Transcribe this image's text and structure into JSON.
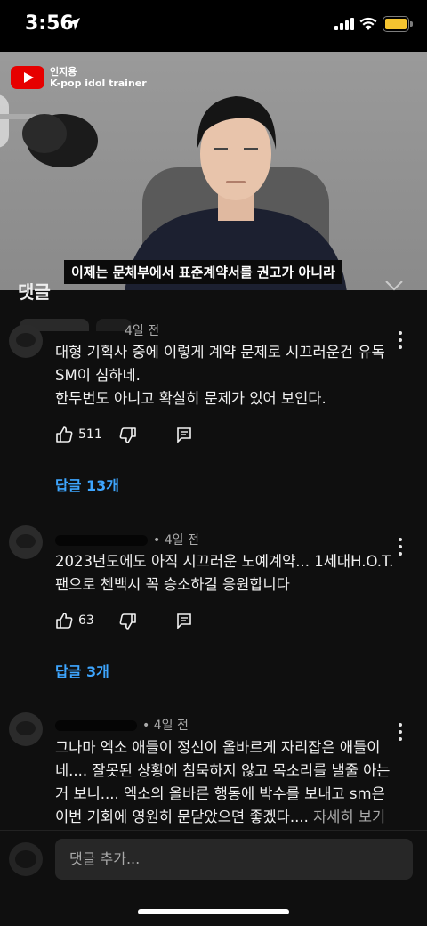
{
  "status": {
    "time": "3:56"
  },
  "video": {
    "channel": "인지용",
    "subtitle_line": "K-pop idol trainer",
    "caption": "이제는 문체부에서 표준계약서를 권고가 아니라"
  },
  "panel": {
    "title_fragment": "댓글"
  },
  "comments": [
    {
      "age": "4일 전",
      "lines": [
        "대형 기획사 중에 이렇게 계약 문제로 시끄러운건 유독",
        "SM이 심하네.",
        "한두번도 아니고 확실히 문제가 있어 보인다."
      ],
      "likes": "511",
      "reply_label": "답글 13개"
    },
    {
      "age": "4일 전",
      "lines": [
        "2023년도에도 아직 시끄러운 노예계약... 1세대H.O.T.",
        "팬으로 첸백시 꼭 승소하길 응원합니다"
      ],
      "likes": "63",
      "reply_label": "답글 3개"
    },
    {
      "age": "4일 전",
      "lines": [
        "그나마 엑소 애들이 정신이 올바르게 자리잡은 애들이",
        "네.... 잘못된 상황에 침묵하지 않고 목소리를 낼줄 아는",
        "거 보니....  엑소의 올바른 행동에 박수를 보내고 sm은",
        "이번 기회에 영원히 문닫았으면 좋겠다...."
      ],
      "more_label": "자세히 보기"
    }
  ],
  "composer": {
    "placeholder": "댓글 추가..."
  }
}
